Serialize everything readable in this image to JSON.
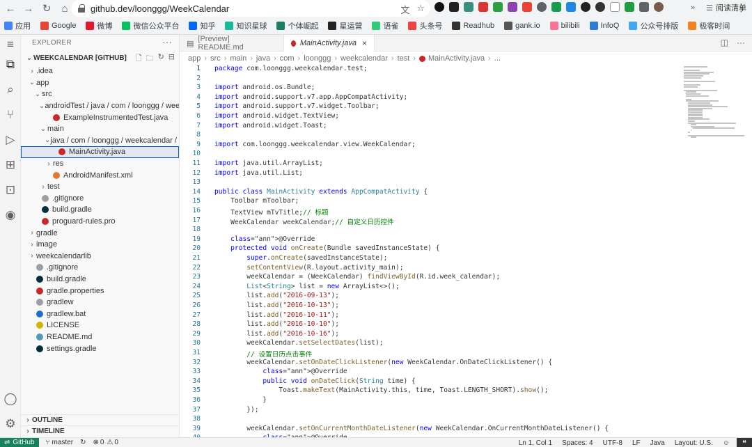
{
  "browser": {
    "url": "github.dev/loonggg/WeekCalendar",
    "bookmarks": [
      {
        "label": "应用",
        "color": "#4285f4"
      },
      {
        "label": "Google",
        "color": "#ea4335"
      },
      {
        "label": "微博",
        "color": "#e6162d"
      },
      {
        "label": "微信公众平台",
        "color": "#07c160"
      },
      {
        "label": "知乎",
        "color": "#0066ff"
      },
      {
        "label": "知识星球",
        "color": "#16b998"
      },
      {
        "label": "个体崛起",
        "color": "#1b7f5f"
      },
      {
        "label": "星运营",
        "color": "#222222"
      },
      {
        "label": "语雀",
        "color": "#31cc79"
      },
      {
        "label": "头条号",
        "color": "#f04142"
      },
      {
        "label": "Readhub",
        "color": "#333333"
      },
      {
        "label": "gank.io",
        "color": "#555555"
      },
      {
        "label": "bilibili",
        "color": "#fb7299"
      },
      {
        "label": "InfoQ",
        "color": "#2e7bd6"
      },
      {
        "label": "公众号排版",
        "color": "#3fa7f5"
      },
      {
        "label": "极客时间",
        "color": "#f58220"
      }
    ],
    "overflow_label": "»",
    "reading_list_label": "阅读清单"
  },
  "sidebar": {
    "title": "EXPLORER",
    "project": "WEEKCALENDAR [GITHUB]",
    "tree": [
      {
        "label": ".idea",
        "depth": 0,
        "twist": "›",
        "icon": ""
      },
      {
        "label": "app",
        "depth": 0,
        "twist": "⌄",
        "icon": ""
      },
      {
        "label": "src",
        "depth": 1,
        "twist": "⌄",
        "icon": ""
      },
      {
        "label": "androidTest / java / com / loonggg / wee...",
        "depth": 2,
        "twist": "⌄",
        "icon": ""
      },
      {
        "label": "ExampleInstrumentedTest.java",
        "depth": 3,
        "twist": "",
        "icon": "#c82829"
      },
      {
        "label": "main",
        "depth": 2,
        "twist": "⌄",
        "icon": ""
      },
      {
        "label": "java / com / loonggg / weekcalendar / t...",
        "depth": 3,
        "twist": "⌄",
        "icon": ""
      },
      {
        "label": "MainActivity.java",
        "depth": 4,
        "twist": "",
        "icon": "#c82829",
        "selected": true
      },
      {
        "label": "res",
        "depth": 3,
        "twist": "›",
        "icon": ""
      },
      {
        "label": "AndroidManifest.xml",
        "depth": 3,
        "twist": "",
        "icon": "#e37933"
      },
      {
        "label": "test",
        "depth": 2,
        "twist": "›",
        "icon": ""
      },
      {
        "label": ".gitignore",
        "depth": 1,
        "twist": "",
        "icon": "#9aa0a6"
      },
      {
        "label": "build.gradle",
        "depth": 1,
        "twist": "",
        "icon": "#02303a"
      },
      {
        "label": "proguard-rules.pro",
        "depth": 1,
        "twist": "",
        "icon": "#c82829"
      },
      {
        "label": "gradle",
        "depth": 0,
        "twist": "›",
        "icon": ""
      },
      {
        "label": "image",
        "depth": 0,
        "twist": "›",
        "icon": ""
      },
      {
        "label": "weekcalendarlib",
        "depth": 0,
        "twist": "›",
        "icon": ""
      },
      {
        "label": ".gitignore",
        "depth": 0,
        "twist": "",
        "icon": "#9aa0a6"
      },
      {
        "label": "build.gradle",
        "depth": 0,
        "twist": "",
        "icon": "#02303a"
      },
      {
        "label": "gradle.properties",
        "depth": 0,
        "twist": "",
        "icon": "#c82829"
      },
      {
        "label": "gradlew",
        "depth": 0,
        "twist": "",
        "icon": "#9aa0a6"
      },
      {
        "label": "gradlew.bat",
        "depth": 0,
        "twist": "",
        "icon": "#1e73c8"
      },
      {
        "label": "LICENSE",
        "depth": 0,
        "twist": "",
        "icon": "#d4b100"
      },
      {
        "label": "README.md",
        "depth": 0,
        "twist": "",
        "icon": "#519aba"
      },
      {
        "label": "settings.gradle",
        "depth": 0,
        "twist": "",
        "icon": "#02303a"
      }
    ],
    "outline_label": "OUTLINE",
    "timeline_label": "TIMELINE"
  },
  "editor": {
    "tabs": [
      {
        "label": "[Preview] README.md",
        "active": false
      },
      {
        "label": "MainActivity.java",
        "active": true
      }
    ],
    "breadcrumbs": [
      "app",
      "src",
      "main",
      "java",
      "com",
      "loonggg",
      "weekcalendar",
      "test",
      "MainActivity.java",
      "..."
    ],
    "current_line": 1,
    "lines": [
      "package com.loonggg.weekcalendar.test;",
      "",
      "import android.os.Bundle;",
      "import android.support.v7.app.AppCompatActivity;",
      "import android.support.v7.widget.Toolbar;",
      "import android.widget.TextView;",
      "import android.widget.Toast;",
      "",
      "import com.loonggg.weekcalendar.view.WeekCalendar;",
      "",
      "import java.util.ArrayList;",
      "import java.util.List;",
      "",
      "public class MainActivity extends AppCompatActivity {",
      "    Toolbar mToolbar;",
      "    TextView mTvTitle;// 标题",
      "    WeekCalendar weekCalendar;// 自定义日历控件",
      "",
      "    @Override",
      "    protected void onCreate(Bundle savedInstanceState) {",
      "        super.onCreate(savedInstanceState);",
      "        setContentView(R.layout.activity_main);",
      "        weekCalendar = (WeekCalendar) findViewById(R.id.week_calendar);",
      "        List<String> list = new ArrayList<>();",
      "        list.add(\"2016-09-13\");",
      "        list.add(\"2016-10-13\");",
      "        list.add(\"2016-10-11\");",
      "        list.add(\"2016-10-10\");",
      "        list.add(\"2016-10-16\");",
      "        weekCalendar.setSelectDates(list);",
      "        // 设置日历点击事件",
      "        weekCalendar.setOnDateClickListener(new WeekCalendar.OnDateClickListener() {",
      "            @Override",
      "            public void onDateClick(String time) {",
      "                Toast.makeText(MainActivity.this, time, Toast.LENGTH_SHORT).show();",
      "            }",
      "        });",
      "",
      "        weekCalendar.setOnCurrentMonthDateListener(new WeekCalendar.OnCurrentMonthDateListener() {",
      "            @Override"
    ]
  },
  "status": {
    "remote": "GitHub",
    "branch": "master",
    "errors": "0",
    "warnings": "0",
    "position": "Ln 1, Col 1",
    "spaces": "Spaces: 4",
    "encoding": "UTF-8",
    "eol": "LF",
    "language": "Java",
    "layout": "Layout: U.S."
  }
}
